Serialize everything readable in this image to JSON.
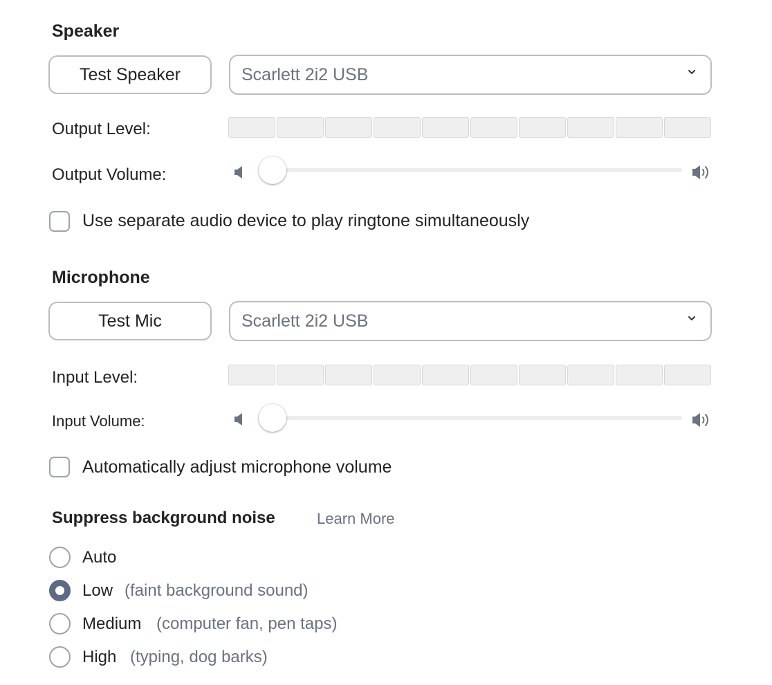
{
  "speaker": {
    "title": "Speaker",
    "test_button": "Test Speaker",
    "device": "Scarlett 2i2 USB",
    "output_level_label": "Output Level:",
    "output_level_value": 0,
    "output_volume_label": "Output Volume:",
    "output_volume_value": 0.03,
    "separate_device_checkbox": {
      "label": "Use separate audio device to play ringtone simultaneously",
      "checked": false
    }
  },
  "microphone": {
    "title": "Microphone",
    "test_button": "Test Mic",
    "device": "Scarlett 2i2 USB",
    "input_level_label": "Input Level:",
    "input_level_value": 0,
    "input_volume_label": "Input Volume:",
    "input_volume_value": 0.03,
    "auto_adjust_checkbox": {
      "label": "Automatically adjust microphone volume",
      "checked": false
    }
  },
  "noise": {
    "title": "Suppress background noise",
    "learn_more": "Learn More",
    "options": [
      {
        "label": "Auto",
        "desc": "",
        "selected": false
      },
      {
        "label": "Low",
        "desc": "(faint background sound)",
        "selected": true
      },
      {
        "label": "Medium",
        "desc": "(computer fan, pen taps)",
        "selected": false
      },
      {
        "label": "High",
        "desc": "(typing, dog barks)",
        "selected": false
      }
    ]
  },
  "icons": {
    "chevron": "chevron-down-icon",
    "volume_low": "speaker-low-icon",
    "volume_high": "speaker-high-icon"
  },
  "colors": {
    "accent": "#5d6a84",
    "border": "#bdbdbd",
    "muted_text": "#6b7280",
    "meter_segment": "#efefef"
  }
}
